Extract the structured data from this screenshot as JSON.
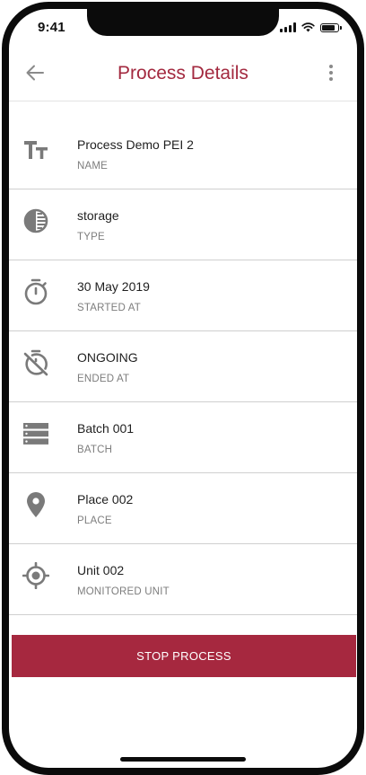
{
  "status_bar": {
    "time": "9:41"
  },
  "header": {
    "title": "Process Details",
    "back_icon": "arrow-left-icon",
    "menu_icon": "more-vertical-icon"
  },
  "details": [
    {
      "icon": "text-size-icon",
      "value": "Process Demo PEI 2",
      "label": "NAME"
    },
    {
      "icon": "contrast-circle-icon",
      "value": "storage",
      "label": "TYPE"
    },
    {
      "icon": "stopwatch-icon",
      "value": "30 May 2019",
      "label": "STARTED AT"
    },
    {
      "icon": "stopwatch-off-icon",
      "value": "ONGOING",
      "label": "ENDED AT"
    },
    {
      "icon": "storage-stack-icon",
      "value": "Batch 001",
      "label": "BATCH"
    },
    {
      "icon": "map-pin-icon",
      "value": "Place 002",
      "label": "PLACE"
    },
    {
      "icon": "target-icon",
      "value": "Unit 002",
      "label": "MONITORED UNIT"
    }
  ],
  "actions": {
    "stop_label": "STOP PROCESS"
  },
  "colors": {
    "accent": "#a6283f",
    "icon": "#8a8a8a",
    "divider": "#cfcfcf"
  }
}
